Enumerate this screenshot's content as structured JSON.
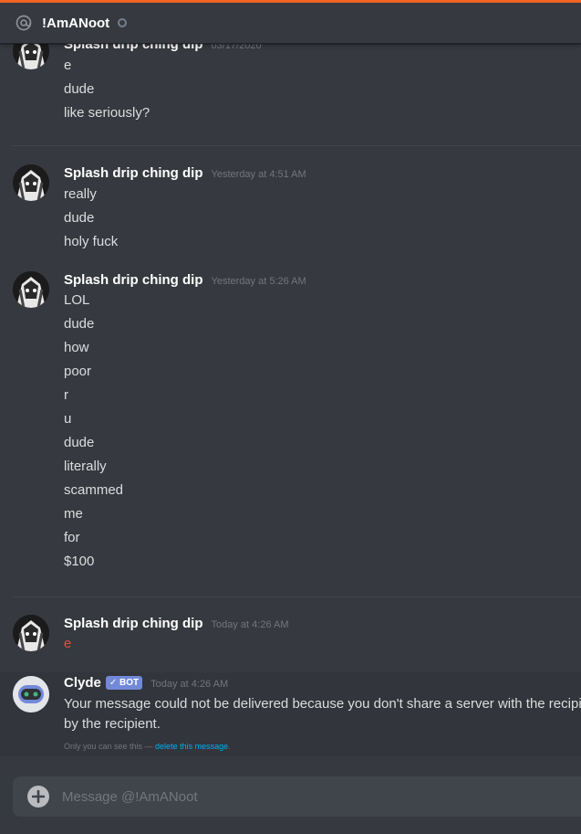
{
  "header": {
    "recipient": "!AmANoot",
    "icon": "at-icon",
    "status": "offline"
  },
  "messages": [
    {
      "author": "Splash drip ching dip",
      "timestamp": "03/17/2020",
      "lines": [
        "e",
        "dude",
        "like seriously?"
      ]
    },
    {
      "author": "Splash drip ching dip",
      "timestamp": "Yesterday at 4:51 AM",
      "lines": [
        "really",
        "dude",
        "holy fuck"
      ]
    },
    {
      "author": "Splash drip ching dip",
      "timestamp": "Yesterday at 5:26 AM",
      "lines": [
        "LOL",
        "dude",
        "how",
        "poor",
        "r",
        "u",
        "dude",
        "literally",
        "scammed",
        "me",
        "for",
        "$100"
      ]
    },
    {
      "author": "Splash drip ching dip",
      "timestamp": "Today at 4:26 AM",
      "lines": [
        "e"
      ],
      "failed": true
    }
  ],
  "clyde": {
    "author": "Clyde",
    "bot_tag": "✓ BOT",
    "timestamp": "Today at 4:26 AM",
    "text_line1": "Your message could not be delivered because you don't share a server with the recipient or you disabled direct messages on your shared server, recipient is only accepting direct messages from friends, or you were blocked",
    "text_line2": "by the recipient.",
    "ephemeral_note": "Only you can see this — ",
    "ephemeral_link": "delete this message"
  },
  "composer": {
    "placeholder": "Message @!AmANoot",
    "value": ""
  },
  "colors": {
    "background": "#36393f",
    "accent_strip": "#f26522",
    "bot_blurple": "#7289da",
    "failed_text": "#f04747",
    "link": "#00b0f4"
  }
}
